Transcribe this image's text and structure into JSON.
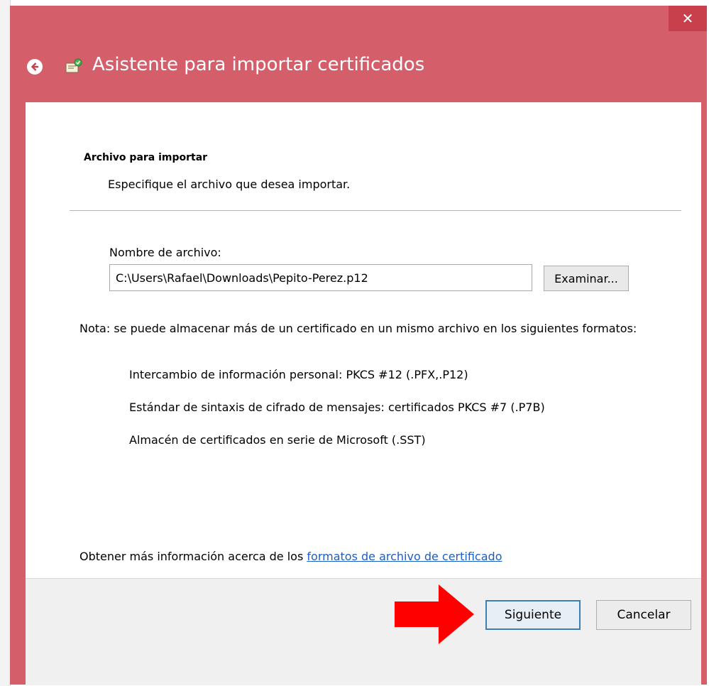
{
  "window": {
    "title": "Asistente para importar certificados",
    "close_glyph": "✕",
    "accent_color": "#d45f6b"
  },
  "section": {
    "title": "Archivo para importar",
    "subtitle": "Especifique el archivo que desea importar."
  },
  "file": {
    "label": "Nombre de archivo:",
    "value": "C:\\Users\\Rafael\\Downloads\\Pepito-Perez.p12",
    "browse_label": "Examinar..."
  },
  "note": {
    "text": "Nota: se puede almacenar más de un certificado en un mismo archivo en los siguientes formatos:",
    "formats": [
      "Intercambio de información personal: PKCS #12 (.PFX,.P12)",
      "Estándar de sintaxis de cifrado de mensajes: certificados PKCS #7 (.P7B)",
      "Almacén de certificados en serie de Microsoft (.SST)"
    ]
  },
  "info": {
    "prefix": "Obtener más información acerca de los",
    "link_text": "formatos de archivo de certificado"
  },
  "buttons": {
    "next": "Siguiente",
    "cancel": "Cancelar"
  },
  "icons": {
    "back": "back-arrow-icon",
    "wizard": "certificate-wizard-icon",
    "annotation": "red-arrow-icon"
  }
}
